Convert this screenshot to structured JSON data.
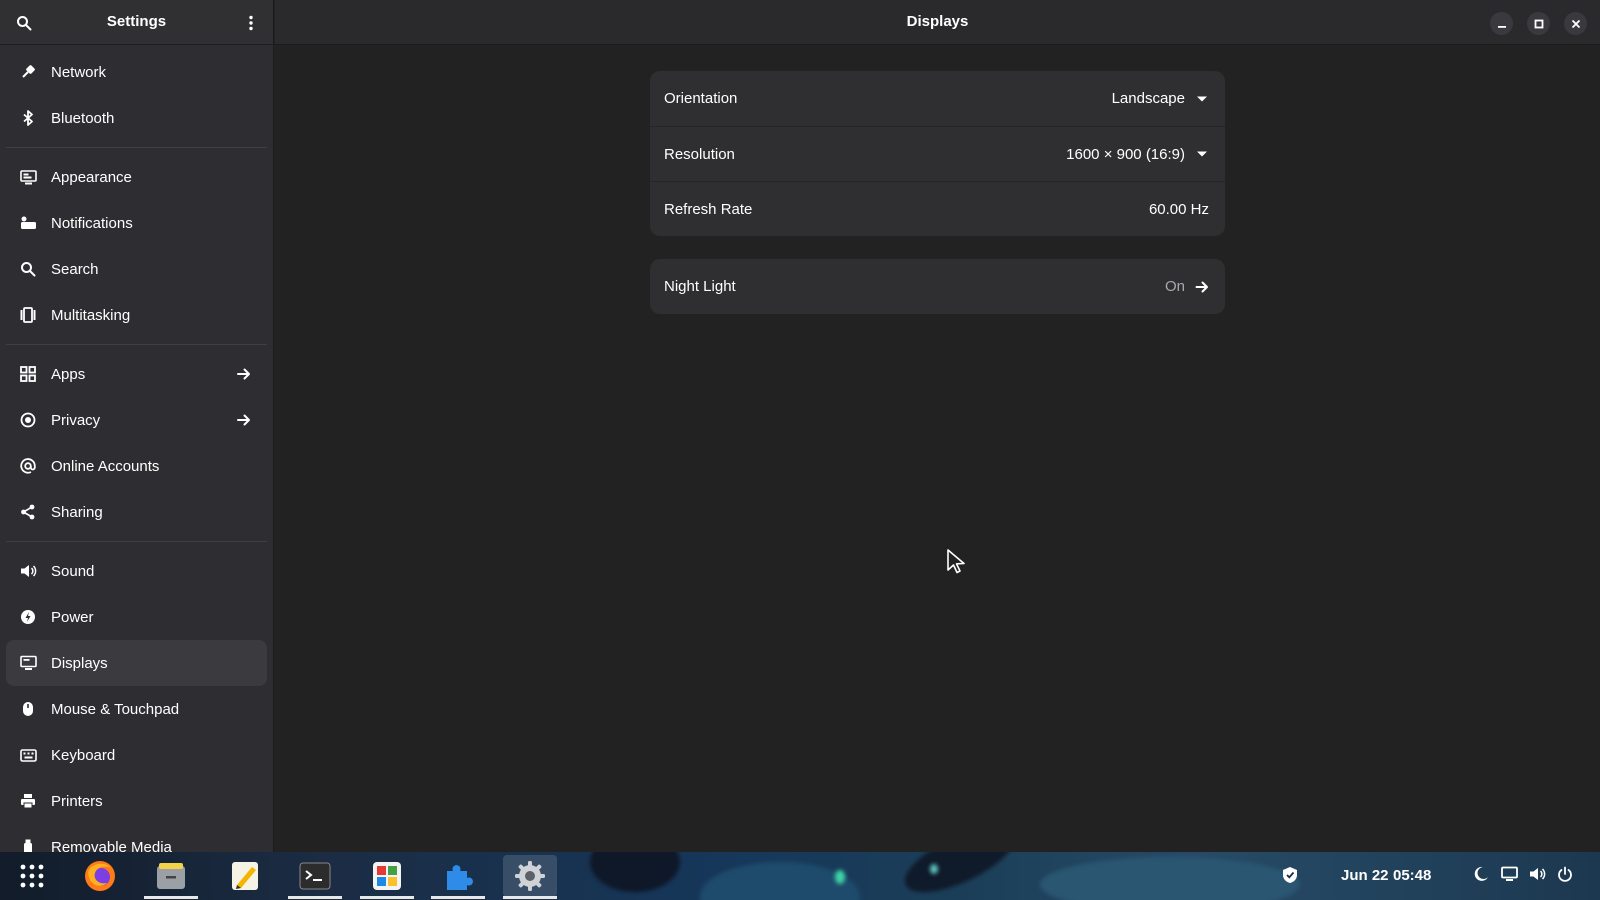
{
  "sidebar": {
    "title": "Settings",
    "groups": [
      [
        {
          "label": "Network",
          "icon": "network-icon"
        },
        {
          "label": "Bluetooth",
          "icon": "bluetooth-icon"
        }
      ],
      [
        {
          "label": "Appearance",
          "icon": "appearance-icon"
        },
        {
          "label": "Notifications",
          "icon": "notifications-icon"
        },
        {
          "label": "Search",
          "icon": "search-icon"
        },
        {
          "label": "Multitasking",
          "icon": "multitasking-icon"
        }
      ],
      [
        {
          "label": "Apps",
          "icon": "apps-icon",
          "arrow": true
        },
        {
          "label": "Privacy",
          "icon": "privacy-icon",
          "arrow": true
        },
        {
          "label": "Online Accounts",
          "icon": "online-accounts-icon"
        },
        {
          "label": "Sharing",
          "icon": "sharing-icon"
        }
      ],
      [
        {
          "label": "Sound",
          "icon": "sound-icon"
        },
        {
          "label": "Power",
          "icon": "power-icon"
        },
        {
          "label": "Displays",
          "icon": "displays-icon",
          "selected": true
        },
        {
          "label": "Mouse & Touchpad",
          "icon": "mouse-icon"
        },
        {
          "label": "Keyboard",
          "icon": "keyboard-icon"
        },
        {
          "label": "Printers",
          "icon": "printer-icon"
        },
        {
          "label": "Removable Media",
          "icon": "removable-media-icon"
        }
      ]
    ]
  },
  "main": {
    "title": "Displays",
    "display_card": {
      "orientation_label": "Orientation",
      "orientation_value": "Landscape",
      "resolution_label": "Resolution",
      "resolution_value": "1600 × 900 (16:9)",
      "refresh_label": "Refresh Rate",
      "refresh_value": "60.00 Hz"
    },
    "night_light": {
      "label": "Night Light",
      "value": "On"
    }
  },
  "taskbar": {
    "apps": [
      "app-grid",
      "firefox",
      "files",
      "text-editor",
      "terminal",
      "software",
      "extensions",
      "settings"
    ],
    "active_app": "settings",
    "date": "Jun 22",
    "time": "05:48"
  },
  "colors": {
    "sidebar_bg": "#2e2e32",
    "main_bg": "#222222",
    "card_bg": "#2f2f32",
    "selected_bg": "#3b3b3f",
    "accent": "#ffffff"
  }
}
